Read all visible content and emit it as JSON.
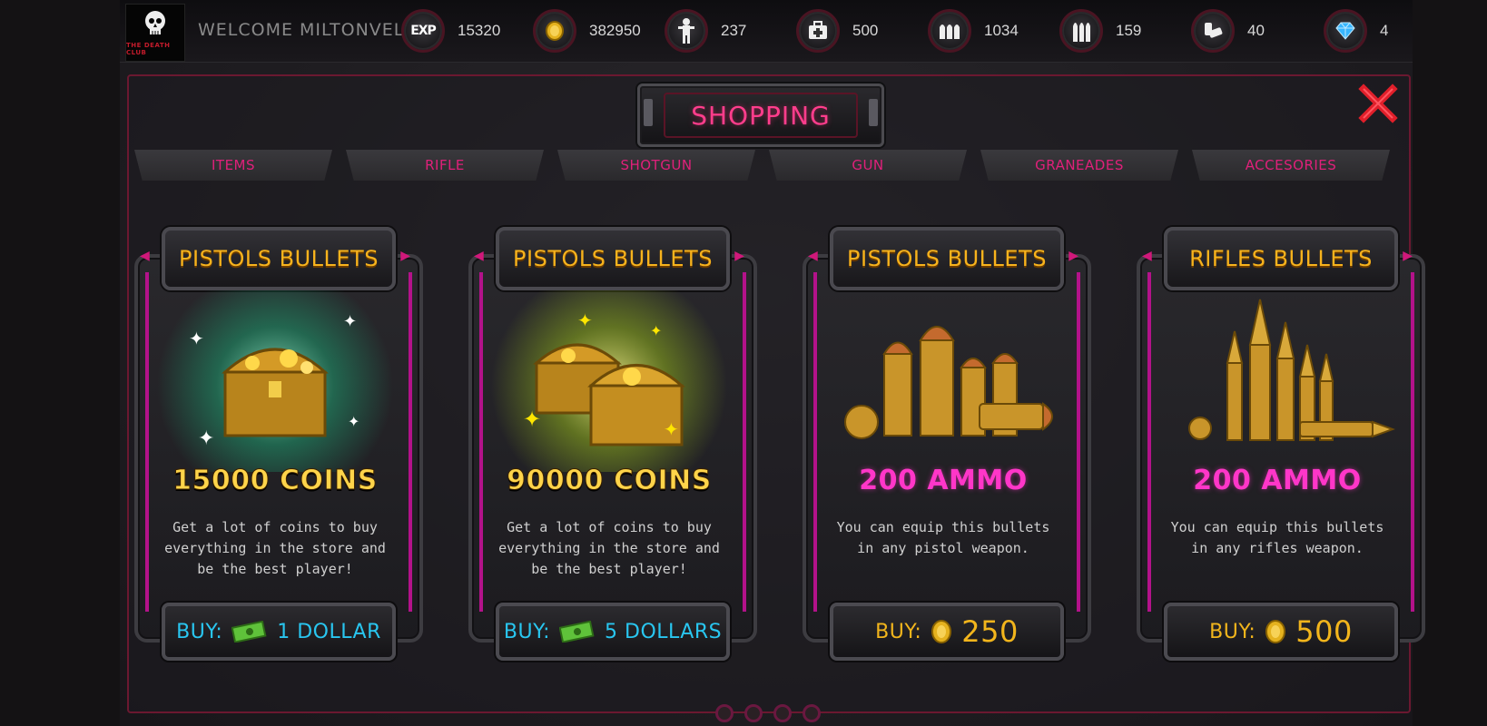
{
  "hud": {
    "logo_text": "THE DEATH CLUB",
    "welcome": "WELCOME MILTONVELI",
    "stats": [
      {
        "icon": "exp-icon",
        "glyph": "EXP",
        "value": "15320"
      },
      {
        "icon": "coin-icon",
        "value": "382950"
      },
      {
        "icon": "zombie-icon",
        "value": "237"
      },
      {
        "icon": "medkit-icon",
        "value": "500"
      },
      {
        "icon": "pistol-ammo-icon",
        "value": "1034"
      },
      {
        "icon": "rifle-ammo-icon",
        "value": "159"
      },
      {
        "icon": "shotgun-shell-icon",
        "value": "40"
      },
      {
        "icon": "diamond-icon",
        "value": "4"
      }
    ]
  },
  "title": "SHOPPING",
  "tabs": [
    "ITEMS",
    "RIFLE",
    "SHOTGUN",
    "GUN",
    "GRANEADES",
    "ACCESORIES"
  ],
  "cards": [
    {
      "title": "PISTOLS BULLETS",
      "amount": "15000 COINS",
      "desc": "Get a lot of coins to buy everything in the store and be the best player!",
      "buy_label": "BUY:",
      "price": "1 DOLLAR",
      "currency": "cash-icon",
      "art": "treasure-chest"
    },
    {
      "title": "PISTOLS BULLETS",
      "amount": "90000 COINS",
      "desc": "Get a lot of coins to buy everything in the store and be the best player!",
      "buy_label": "BUY:",
      "price": "5 DOLLARS",
      "currency": "cash-icon",
      "art": "treasure-chests"
    },
    {
      "title": "PISTOLS BULLETS",
      "amount": "200 AMMO",
      "desc": "You can equip this bullets in any pistol weapon.",
      "buy_label": "BUY:",
      "price": "250",
      "currency": "coin-icon",
      "art": "pistol-bullets"
    },
    {
      "title": "RIFLES BULLETS",
      "amount": "200 AMMO",
      "desc": "You can equip this bullets in any rifles weapon.",
      "buy_label": "BUY:",
      "price": "500",
      "currency": "coin-icon",
      "art": "rifle-bullets"
    }
  ],
  "colors": {
    "accent": "#ff3d8c",
    "gold": "#f7b31d",
    "cash": "#29c6f0",
    "ammo": "#ff36c8"
  }
}
